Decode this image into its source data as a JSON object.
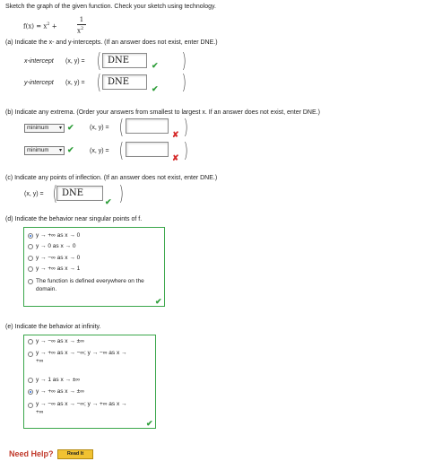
{
  "instruction": "Sketch the graph of the given function. Check your sketch using technology.",
  "function": {
    "lhs": "f(x) = x",
    "exp": "2",
    "plus": "+",
    "num": "1",
    "den": "x",
    "den_exp": "2"
  },
  "part_a": {
    "prompt": "(a)   Indicate the x- and y-intercepts. (If an answer does not exist, enter DNE.)",
    "x_label": "x-intercept",
    "y_label": "y-intercept",
    "pair": "(x, y) =",
    "x_value": "DNE",
    "y_value": "DNE"
  },
  "part_b": {
    "prompt": "(b)   Indicate any extrema. (Order your answers from smallest to largest x. If an answer does not exist, enter DNE.)",
    "select1": "minimum",
    "select2": "minimum",
    "pair": "(x, y) ="
  },
  "part_c": {
    "prompt": "(c)   Indicate any points of inflection. (If an answer does not exist, enter DNE.)",
    "pair": "(x, y) =",
    "value": "DNE"
  },
  "part_d": {
    "prompt": "(d)   Indicate the behavior near singular points of f.",
    "options": [
      "y → +∞ as x → 0",
      "y → 0 as x → 0",
      "y → −∞ as x → 0",
      "y → +∞ as x → 1",
      "The function is defined everywhere on the",
      "domain."
    ]
  },
  "part_e": {
    "prompt": "(e)   Indicate the behavior at infinity.",
    "options": [
      "y → −∞ as x → ±∞",
      "y → +∞ as x → −∞; y → −∞ as x →",
      "+∞",
      "y → 1 as x → ±∞",
      "y → +∞ as x → ±∞",
      "y → −∞ as x → −∞; y → +∞ as x →",
      "+∞"
    ]
  },
  "help": {
    "label": "Need Help?",
    "button": "Read It"
  },
  "colors": {
    "correct": "#2e9e3a",
    "incorrect": "#d62b2b",
    "help": "#c0392b",
    "button": "#f1c232"
  }
}
